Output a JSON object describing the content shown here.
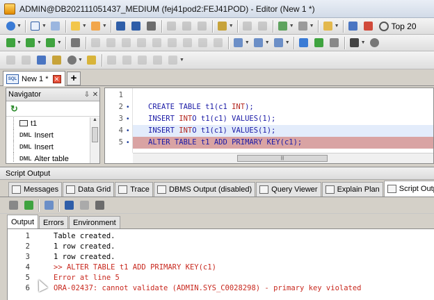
{
  "window": {
    "title": "ADMIN@DB202111051437_MEDIUM (fej41pod2:FEJ41POD) - Editor (New 1 *)"
  },
  "toolbar": {
    "top_label": "Top 20"
  },
  "doc_tabs": [
    {
      "label": "New 1 *"
    }
  ],
  "navigator": {
    "title": "Navigator",
    "items": [
      {
        "type": "table",
        "label": "t1"
      },
      {
        "type": "DML",
        "label": "Insert"
      },
      {
        "type": "DML",
        "label": "Insert"
      },
      {
        "type": "DML",
        "label": "Alter table"
      }
    ]
  },
  "editor": {
    "lines": [
      {
        "num": "1",
        "text": ""
      },
      {
        "num": "2",
        "text": "CREATE TABLE t1(c1 INT);"
      },
      {
        "num": "3",
        "text": "INSERT INTO t1(c1) VALUES(1);"
      },
      {
        "num": "4",
        "text": "INSERT INTO t1(c1) VALUES(1);"
      },
      {
        "num": "5",
        "text": "ALTER TABLE t1 ADD PRIMARY KEY(c1);"
      }
    ]
  },
  "script_output": {
    "title": "Script Output",
    "tabs": [
      {
        "label": "Messages"
      },
      {
        "label": "Data Grid"
      },
      {
        "label": "Trace"
      },
      {
        "label": "DBMS Output (disabled)"
      },
      {
        "label": "Query Viewer"
      },
      {
        "label": "Explain Plan"
      },
      {
        "label": "Script Output"
      }
    ],
    "inner_tabs": [
      {
        "label": "Output"
      },
      {
        "label": "Errors"
      },
      {
        "label": "Environment"
      }
    ],
    "lines": [
      {
        "num": "1",
        "text": "Table created."
      },
      {
        "num": "2",
        "text": "1 row created."
      },
      {
        "num": "3",
        "text": "1 row created."
      },
      {
        "num": "4",
        "text": ">> ALTER TABLE t1 ADD PRIMARY KEY(c1)"
      },
      {
        "num": "5",
        "text": "Error at line 5"
      },
      {
        "num": "6",
        "text": "ORA-02437: cannot validate (ADMIN.SYS_C0028298) - primary key violated"
      }
    ]
  },
  "colors": {
    "error_text": "#c8281e",
    "keyword": "#1a1aa6",
    "error_line_bg": "#d9a3a3",
    "current_line_bg": "#e3ecfb"
  }
}
